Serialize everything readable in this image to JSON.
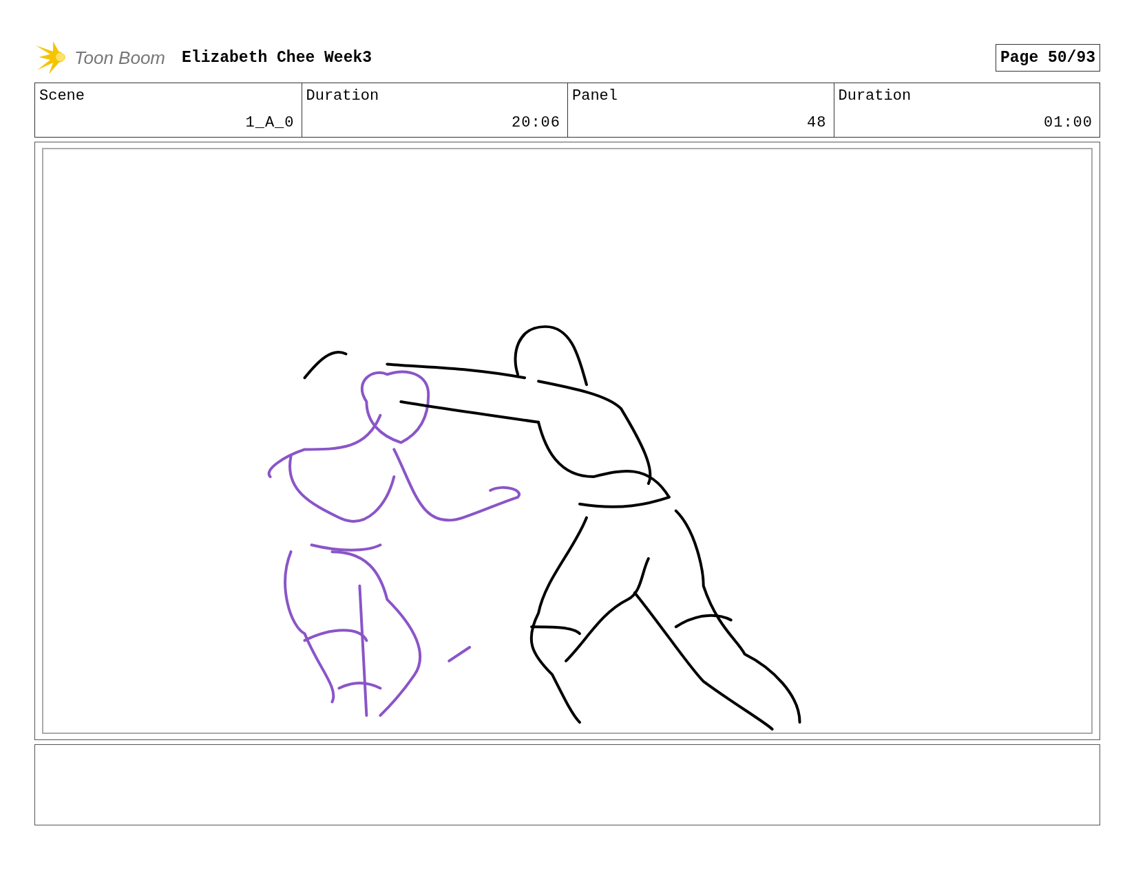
{
  "header": {
    "logo_text": "Toon Boom",
    "title": "Elizabeth Chee Week3",
    "page": "Page 50/93"
  },
  "info_table": {
    "columns": [
      "Scene",
      "Duration",
      "Panel",
      "Duration"
    ],
    "values": [
      "1_A_0",
      "20:06",
      "48",
      "01:00"
    ]
  }
}
